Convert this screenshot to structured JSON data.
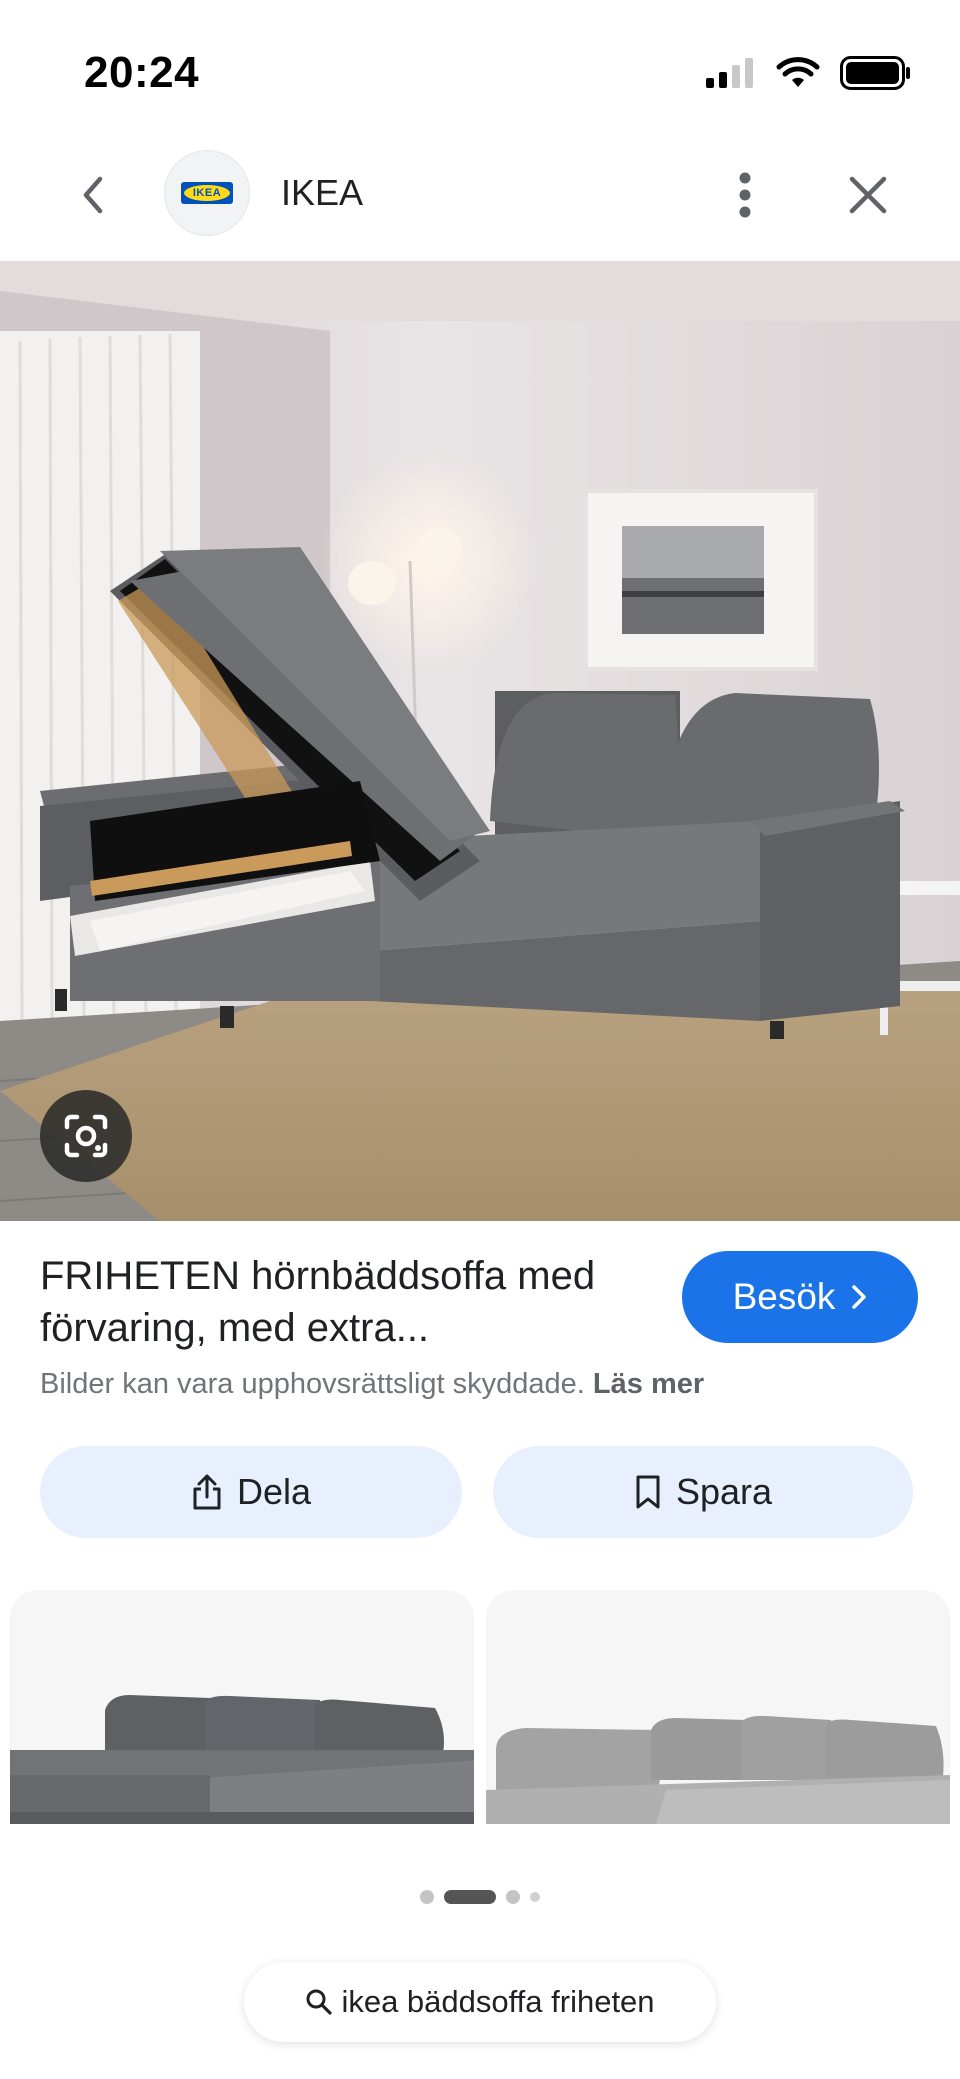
{
  "status_bar": {
    "time": "20:24"
  },
  "top_nav": {
    "site_name": "IKEA",
    "logo_text": "IKEA"
  },
  "result": {
    "title": "FRIHETEN hörnbäddsoffa med förvaring, med extra...",
    "visit_label": "Besök",
    "copyright_notice": "Bilder kan vara upphovsrättsligt skyddade.",
    "read_more_label": "Läs mer"
  },
  "actions": {
    "share_label": "Dela",
    "save_label": "Spara"
  },
  "pager": {
    "pages": 4,
    "active_index": 1
  },
  "search_chip": {
    "query": "ikea bäddsoffa friheten"
  },
  "colors": {
    "accent": "#1a73e8",
    "pill_bg": "#e8f0fe",
    "sofa_gray": "#6c6d70"
  },
  "icons": [
    "back-icon",
    "more-vert-icon",
    "close-icon",
    "lens-icon",
    "chevron-right-icon",
    "share-icon",
    "bookmark-icon",
    "search-icon"
  ]
}
